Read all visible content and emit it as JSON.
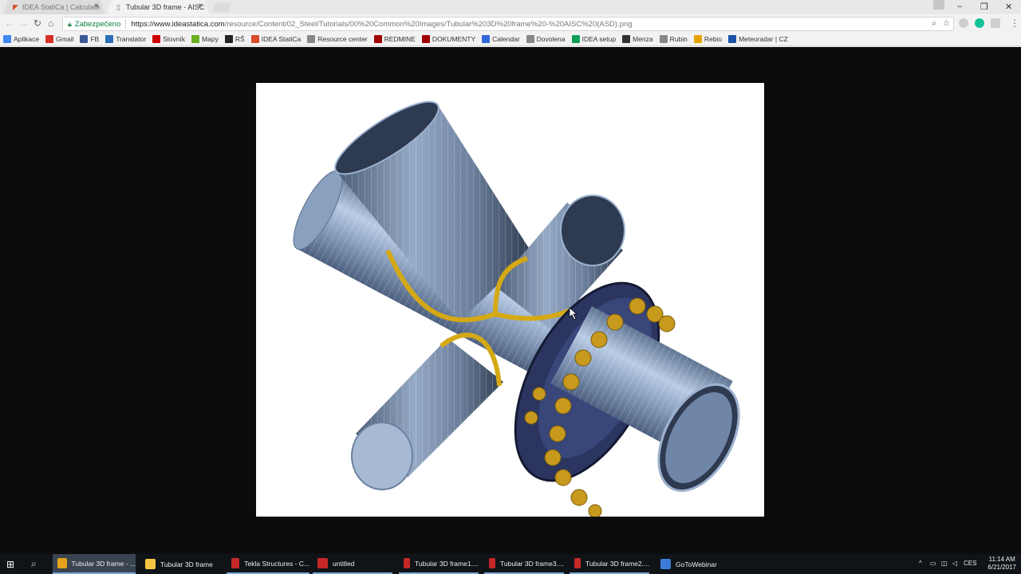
{
  "tabs": [
    {
      "title": "IDEA StatiCa | Calculate ",
      "active": false
    },
    {
      "title": "Tubular 3D frame - AISC",
      "active": true
    }
  ],
  "toolbar": {
    "secure_label": "Zabezpečeno",
    "url_host": "https://www.ideastatica.com",
    "url_path": "/resource/Content/02_Steel/Tutorials/00%20Common%20Images/Tubular%203D%20frame%20-%20AISC%20(ASD).png"
  },
  "bookmarks": [
    {
      "label": "Aplikace",
      "icon": "apps-grid-icon",
      "color": "#4285f4"
    },
    {
      "label": "Gmail",
      "icon": "gmail-icon",
      "color": "#d93025"
    },
    {
      "label": "FB",
      "icon": "facebook-icon",
      "color": "#3b5998"
    },
    {
      "label": "Translator",
      "icon": "translator-icon",
      "color": "#2b6fb6"
    },
    {
      "label": "Slovník",
      "icon": "slovnik-icon",
      "color": "#cc0000"
    },
    {
      "label": "Mapy",
      "icon": "mapy-icon",
      "color": "#6ab023"
    },
    {
      "label": "RŠ",
      "icon": "rs-icon",
      "color": "#222222"
    },
    {
      "label": "IDEA StatiCa",
      "icon": "idea-statica-icon",
      "color": "#d94b2b"
    },
    {
      "label": "Resource center",
      "icon": "page-icon",
      "color": "#888888"
    },
    {
      "label": "REDMINE",
      "icon": "redmine-icon",
      "color": "#a00000"
    },
    {
      "label": "DOKUMENTY",
      "icon": "dokumenty-icon",
      "color": "#a00000"
    },
    {
      "label": "Calendar",
      "icon": "calendar-icon",
      "color": "#3367d6"
    },
    {
      "label": "Dovolena",
      "icon": "page-icon",
      "color": "#888888"
    },
    {
      "label": "IDEA setup",
      "icon": "sheets-icon",
      "color": "#0f9d58"
    },
    {
      "label": "Menza",
      "icon": "menza-icon",
      "color": "#333333"
    },
    {
      "label": "Rubin",
      "icon": "page-icon",
      "color": "#888888"
    },
    {
      "label": "Rebio",
      "icon": "rebio-icon",
      "color": "#e8a400"
    },
    {
      "label": "Meteoradar | CZ",
      "icon": "meteoradar-icon",
      "color": "#1a53a6"
    }
  ],
  "image": {
    "alt_name": "tubular-3d-frame-render",
    "colors": {
      "tube": "#8fa6c4",
      "tube_dark": "#3f4f66",
      "weld": "#d4a915",
      "flange": "#2b3560",
      "bolt": "#c79a1e"
    }
  },
  "taskbar": {
    "items": [
      {
        "label": "Tubular 3D frame - ...",
        "icon": "chrome-icon",
        "color": "#e4a11b",
        "state": "active"
      },
      {
        "label": "Tubular 3D frame",
        "icon": "folder-icon",
        "color": "#f4c542",
        "state": "none"
      },
      {
        "label": "Tekla Structures - C...",
        "icon": "tekla-icon",
        "color": "#c62828",
        "state": "open"
      },
      {
        "label": "untitled",
        "icon": "idea-app-icon",
        "color": "#c62828",
        "state": "open"
      },
      {
        "label": "Tubular 3D frame1....",
        "icon": "idea-app-icon",
        "color": "#c62828",
        "state": "open"
      },
      {
        "label": "Tubular 3D frame3....",
        "icon": "idea-app-icon",
        "color": "#c62828",
        "state": "open"
      },
      {
        "label": "Tubular 3D frame2....",
        "icon": "idea-app-icon",
        "color": "#c62828",
        "state": "open"
      },
      {
        "label": "GoToWebinar",
        "icon": "gotowebinar-icon",
        "color": "#3d7bd9",
        "state": "none"
      }
    ],
    "language": "CES",
    "time": "11:14 AM",
    "date": "6/21/2017"
  }
}
